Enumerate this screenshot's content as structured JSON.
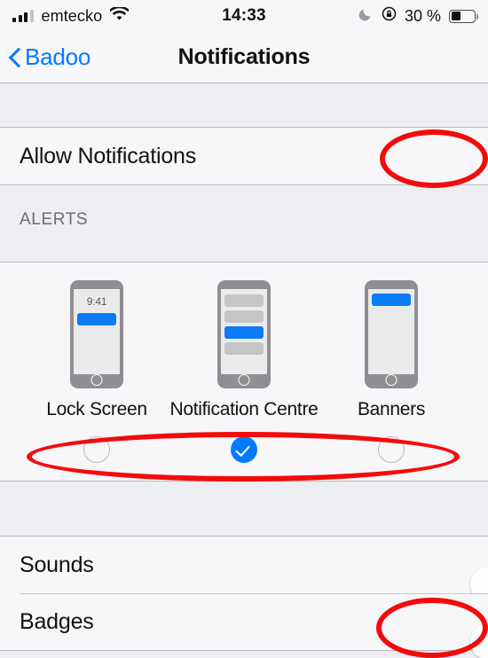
{
  "status_bar": {
    "carrier": "emtecko",
    "time": "14:33",
    "battery_percent": "30 %",
    "signal_icon": "signal-bars-icon",
    "wifi_icon": "wifi-icon",
    "dnd_icon": "moon-icon",
    "rotation_lock_icon": "rotation-lock-icon",
    "battery_icon": "battery-icon",
    "signal_bars_filled": 3,
    "signal_bars_total": 4
  },
  "nav": {
    "back_label": "Badoo",
    "back_icon": "chevron-left-icon",
    "title": "Notifications"
  },
  "allow": {
    "label": "Allow Notifications",
    "state": "on"
  },
  "alerts": {
    "header": "ALERTS",
    "options": [
      {
        "label": "Lock Screen",
        "selected": false,
        "preview": "lock-screen",
        "preview_time": "9:41"
      },
      {
        "label": "Notification Centre",
        "selected": true,
        "preview": "notification-centre"
      },
      {
        "label": "Banners",
        "selected": false,
        "preview": "banners"
      }
    ]
  },
  "options_rows": [
    {
      "label": "Sounds",
      "state": "off"
    },
    {
      "label": "Badges",
      "state": "off"
    }
  ],
  "annotations": [
    {
      "name": "allow-notifications-toggle-highlight"
    },
    {
      "name": "alert-style-radios-highlight"
    },
    {
      "name": "badges-toggle-highlight"
    }
  ],
  "colors": {
    "accent_blue": "#017aff",
    "toggle_on_green": "#28cc4b",
    "annotation_red": "#f30b0b",
    "group_bg": "#f7f7f9",
    "page_bg": "#eceef1"
  }
}
